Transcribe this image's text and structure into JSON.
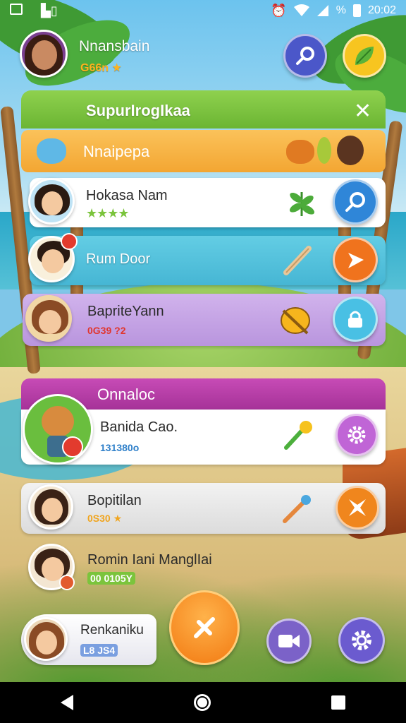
{
  "status_bar": {
    "time": "20:02",
    "battery": "%",
    "icons": [
      "screenshot-icon",
      "gallery-icon",
      "alarm-icon",
      "wifi-icon",
      "signal-icon",
      "battery-icon"
    ]
  },
  "header": {
    "player_name": "Nnansbain",
    "coins": "G66n ★",
    "search_icon": "search-icon",
    "leaf_icon": "leaf-icon"
  },
  "panel": {
    "title": "SupurIrogIkaa",
    "close_icon": "close-icon"
  },
  "friends_section": {
    "title": "Nnaipepa",
    "rows": [
      {
        "name": "Hokasa Nam",
        "sub": "★★★★",
        "sub_color": "#7bc43c",
        "item_icon": "leaf-icon",
        "action_icon": "search-icon",
        "action_color": "#2f86d8",
        "row_color": "#ffffff"
      },
      {
        "name": "Rum Door",
        "sub": "",
        "sub_color": "#ffffff",
        "item_icon": "bat-icon",
        "action_icon": "play-icon",
        "action_color": "#f0731d",
        "row_color": "#5cc6de"
      },
      {
        "name": "BapriteYann",
        "sub": "0G39 ?2",
        "sub_color": "#e0362e",
        "item_icon": "shell-icon",
        "action_icon": "lock-icon",
        "action_color": "#49c0e4",
        "row_color": "#c9a7e8"
      }
    ]
  },
  "online_section": {
    "title": "Onnaloc",
    "rows": [
      {
        "name": "Banida Cao.",
        "sub": "131380o",
        "sub_color": "#2e7fc9",
        "item_icon": "microphone-icon",
        "action_icon": "settings-icon",
        "action_color": "#c065d6",
        "row_color": "#ffffff"
      },
      {
        "name": "Bopitilan",
        "sub": "0S30 ★",
        "sub_color": "#f0a51f",
        "item_icon": "brush-icon",
        "action_icon": "star-x-icon",
        "action_color": "#f0861d",
        "row_color": "#e8e8e8"
      },
      {
        "name": "Romin Iani ManglIai",
        "sub": "00 0105Y",
        "sub_color": "#7bc43c",
        "item_icon": "",
        "action_icon": "",
        "action_color": "",
        "row_color": ""
      }
    ]
  },
  "bottom_bar": {
    "profile_name": "Renkaniku",
    "profile_sub": "L8 JS4",
    "main_action_icon": "close-icon",
    "video_icon": "video-icon",
    "settings_icon": "settings-icon"
  },
  "colors": {
    "panel_green": "#7cc43f",
    "friends_orange": "#f7b243",
    "online_magenta": "#b63ca6",
    "main_button_orange": "#f7851d"
  },
  "nav_bar": {
    "icons": [
      "back-icon",
      "home-icon",
      "recent-apps-icon"
    ]
  }
}
